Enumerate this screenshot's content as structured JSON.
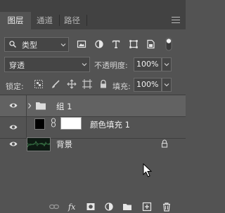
{
  "tabs": [
    {
      "label": "图层"
    },
    {
      "label": "通道"
    },
    {
      "label": "路径"
    }
  ],
  "filter": {
    "kind_label": "类型"
  },
  "blend": {
    "mode": "穿透",
    "opacity_label": "不透明度:",
    "opacity_value": "100%"
  },
  "lock": {
    "label": "锁定:",
    "fill_label": "填充:",
    "fill_value": "100%"
  },
  "layers": [
    {
      "name": "组 1",
      "type": "group",
      "selected": true
    },
    {
      "name": "颜色填充 1",
      "type": "color-fill",
      "fill_color": "#000000"
    },
    {
      "name": "背景",
      "type": "background",
      "locked": true
    }
  ],
  "colors": {
    "panel_bg": "#535353",
    "tab_bar": "#424242",
    "selected_row": "#626262"
  },
  "icons": [
    "search-icon",
    "chevron-down-icon",
    "pixel-filter-icon",
    "adjustment-filter-icon",
    "type-filter-icon",
    "shape-filter-icon",
    "smart-object-filter-icon",
    "filter-toggle-icon",
    "lock-transparent-icon",
    "lock-brush-icon",
    "lock-move-icon",
    "lock-artboard-icon",
    "lock-all-icon",
    "eye-icon",
    "folder-icon",
    "link-icon",
    "lock-icon",
    "link-layers-icon",
    "fx-icon",
    "mask-icon",
    "adjustment-icon",
    "new-group-icon",
    "new-layer-icon",
    "trash-icon",
    "panel-menu-icon",
    "mouse-cursor-icon"
  ]
}
